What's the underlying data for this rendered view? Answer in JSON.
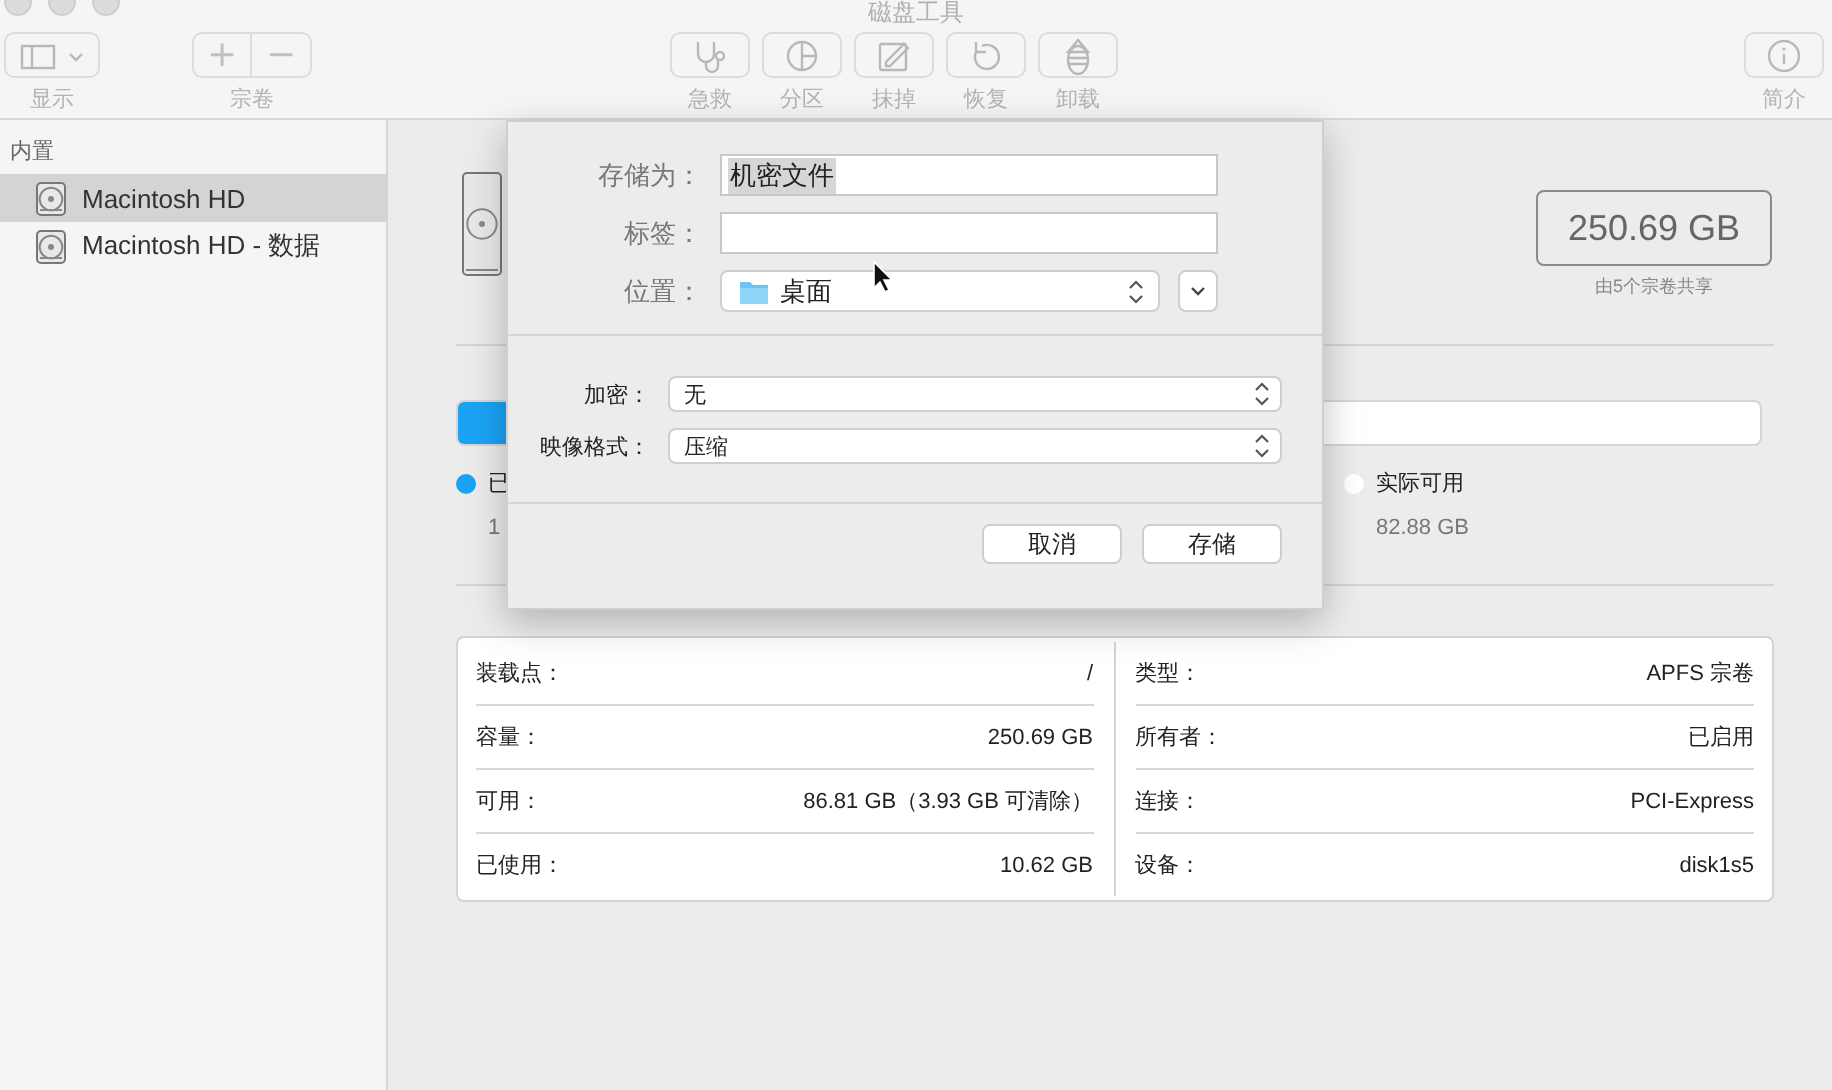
{
  "window": {
    "title": "磁盘工具"
  },
  "toolbar": {
    "left": [
      {
        "kind": "view",
        "label": "显示"
      },
      {
        "kind": "plusminus",
        "label": "宗卷",
        "buttons": [
          "+",
          "−"
        ]
      }
    ],
    "center": [
      {
        "kind": "firstaid",
        "label": "急救"
      },
      {
        "kind": "partition",
        "label": "分区"
      },
      {
        "kind": "erase",
        "label": "抹掉"
      },
      {
        "kind": "restore",
        "label": "恢复"
      },
      {
        "kind": "unmount",
        "label": "卸载"
      }
    ],
    "right": [
      {
        "kind": "info",
        "label": "简介"
      }
    ]
  },
  "sidebar": {
    "section": "内置",
    "items": [
      {
        "label": "Macintosh HD",
        "selected": true
      },
      {
        "label": "Macintosh HD - 数据",
        "selected": false
      }
    ]
  },
  "capacity": {
    "size": "250.69 GB",
    "shared": "由5个宗卷共享"
  },
  "usage": {
    "segments": [
      {
        "color": "#1aa3f5",
        "level": 0.042
      }
    ],
    "legend": [
      {
        "label": "已",
        "value": "1",
        "color": "#1aa3f5"
      },
      {
        "label": "实际可用",
        "value": "82.88 GB",
        "color": "#ffffff"
      }
    ]
  },
  "info": {
    "left": [
      {
        "label": "装载点：",
        "value": "/"
      },
      {
        "label": "容量：",
        "value": "250.69 GB"
      },
      {
        "label": "可用：",
        "value": "86.81 GB（3.93 GB 可清除）"
      },
      {
        "label": "已使用：",
        "value": "10.62 GB"
      }
    ],
    "right": [
      {
        "label": "类型：",
        "value": "APFS 宗卷"
      },
      {
        "label": "所有者：",
        "value": "已启用"
      },
      {
        "label": "连接：",
        "value": "PCI-Express"
      },
      {
        "label": "设备：",
        "value": "disk1s5"
      }
    ]
  },
  "sheet": {
    "fields": [
      {
        "kind": "text",
        "label": "存储为：",
        "value": "机密文件",
        "highlighted": true
      },
      {
        "kind": "text",
        "label": "标签："
      },
      {
        "kind": "location",
        "label": "位置：",
        "value": "桌面"
      }
    ],
    "options": [
      {
        "label": "加密：",
        "value": "无"
      },
      {
        "label": "映像格式：",
        "value": "压缩"
      }
    ],
    "buttons": [
      "取消",
      "存储"
    ]
  }
}
